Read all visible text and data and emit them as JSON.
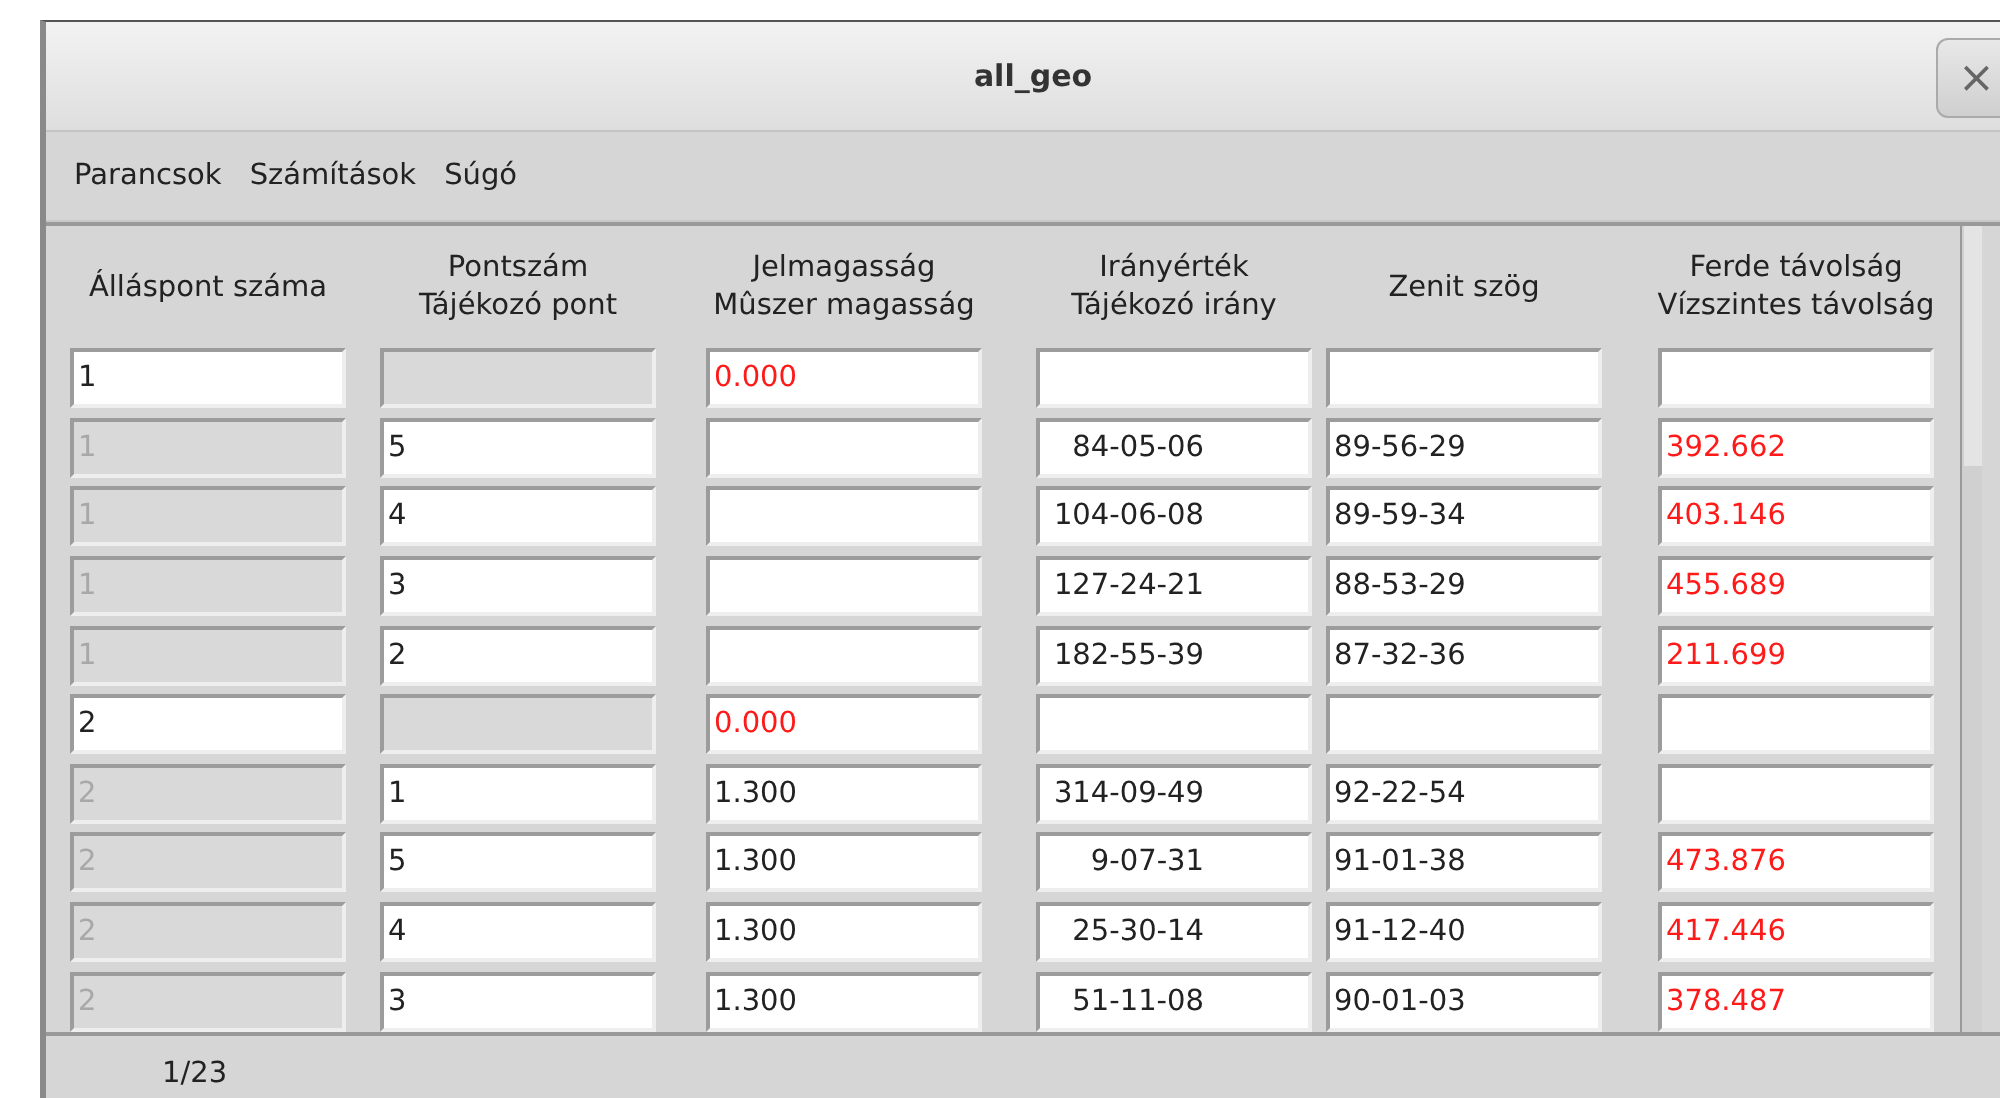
{
  "window": {
    "title": "all_geo",
    "close": "×"
  },
  "menu": [
    "Parancsok",
    "Számítások",
    "Súgó"
  ],
  "table": {
    "columns": [
      "Álláspont száma",
      "Pontszám\nTájékozó pont",
      "Jelmagasság\nMûszer magasság",
      "Irányérték\nTájékozó irány",
      "Zenit szög",
      "Ferde távolság\nVízszintes távolság"
    ],
    "rows": [
      [
        {
          "value": "1",
          "disabled": false,
          "computed": false
        },
        {
          "disabled": true
        },
        {
          "value": "0.000",
          "disabled": false,
          "computed": true
        },
        {
          "disabled": false
        },
        {
          "disabled": false
        },
        {
          "disabled": false
        }
      ],
      [
        {
          "value": "1",
          "disabled": true,
          "computed": false
        },
        {
          "value": "5",
          "disabled": false,
          "computed": false
        },
        {
          "disabled": false
        },
        {
          "value": "84-05-06",
          "disabled": false,
          "computed": false
        },
        {
          "value": "89-56-29",
          "disabled": false,
          "computed": false
        },
        {
          "value": "392.662",
          "disabled": false,
          "computed": true
        }
      ],
      [
        {
          "value": "1",
          "disabled": true,
          "computed": false
        },
        {
          "value": "4",
          "disabled": false,
          "computed": false
        },
        {
          "disabled": false
        },
        {
          "value": "104-06-08",
          "disabled": false,
          "computed": false
        },
        {
          "value": "89-59-34",
          "disabled": false,
          "computed": false
        },
        {
          "value": "403.146",
          "disabled": false,
          "computed": true
        }
      ],
      [
        {
          "value": "1",
          "disabled": true,
          "computed": false
        },
        {
          "value": "3",
          "disabled": false,
          "computed": false
        },
        {
          "disabled": false
        },
        {
          "value": "127-24-21",
          "disabled": false,
          "computed": false
        },
        {
          "value": "88-53-29",
          "disabled": false,
          "computed": false
        },
        {
          "value": "455.689",
          "disabled": false,
          "computed": true
        }
      ],
      [
        {
          "value": "1",
          "disabled": true,
          "computed": false
        },
        {
          "value": "2",
          "disabled": false,
          "computed": false
        },
        {
          "disabled": false
        },
        {
          "value": "182-55-39",
          "disabled": false,
          "computed": false
        },
        {
          "value": "87-32-36",
          "disabled": false,
          "computed": false
        },
        {
          "value": "211.699",
          "disabled": false,
          "computed": true
        }
      ],
      [
        {
          "value": "2",
          "disabled": false,
          "computed": false
        },
        {
          "disabled": true
        },
        {
          "value": "0.000",
          "disabled": false,
          "computed": true
        },
        {
          "disabled": false
        },
        {
          "disabled": false
        },
        {
          "disabled": false
        }
      ],
      [
        {
          "value": "2",
          "disabled": true,
          "computed": false
        },
        {
          "value": "1",
          "disabled": false,
          "computed": false
        },
        {
          "value": "1.300",
          "disabled": false,
          "computed": false
        },
        {
          "value": "314-09-49",
          "disabled": false,
          "computed": false
        },
        {
          "value": "92-22-54",
          "disabled": false,
          "computed": false
        },
        {
          "disabled": false
        }
      ],
      [
        {
          "value": "2",
          "disabled": true,
          "computed": false
        },
        {
          "value": "5",
          "disabled": false,
          "computed": false
        },
        {
          "value": "1.300",
          "disabled": false,
          "computed": false
        },
        {
          "value": "9-07-31",
          "disabled": false,
          "computed": false
        },
        {
          "value": "91-01-38",
          "disabled": false,
          "computed": false
        },
        {
          "value": "473.876",
          "disabled": false,
          "computed": true
        }
      ],
      [
        {
          "value": "2",
          "disabled": true,
          "computed": false
        },
        {
          "value": "4",
          "disabled": false,
          "computed": false
        },
        {
          "value": "1.300",
          "disabled": false,
          "computed": false
        },
        {
          "value": "25-30-14",
          "disabled": false,
          "computed": false
        },
        {
          "value": "91-12-40",
          "disabled": false,
          "computed": false
        },
        {
          "value": "417.446",
          "disabled": false,
          "computed": true
        }
      ],
      [
        {
          "value": "2",
          "disabled": true,
          "computed": false
        },
        {
          "value": "3",
          "disabled": false,
          "computed": false
        },
        {
          "value": "1.300",
          "disabled": false,
          "computed": false
        },
        {
          "value": "51-11-08",
          "disabled": false,
          "computed": false
        },
        {
          "value": "90-01-03",
          "disabled": false,
          "computed": false
        },
        {
          "value": "378.487",
          "disabled": false,
          "computed": true
        }
      ]
    ]
  },
  "status_bar": "1/23"
}
